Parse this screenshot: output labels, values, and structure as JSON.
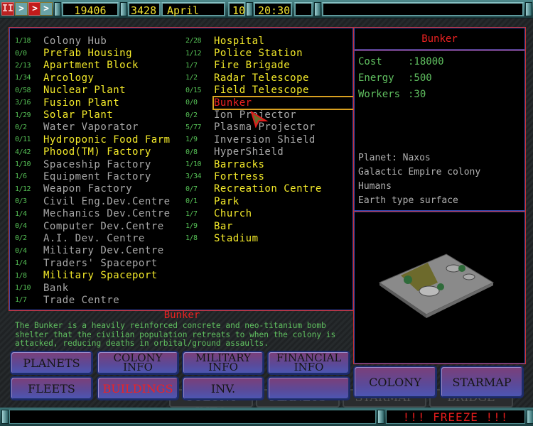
{
  "topbar": {
    "controls": [
      {
        "icon": "pause-icon",
        "glyph": "II"
      },
      {
        "icon": "play-icon",
        "glyph": ">"
      },
      {
        "icon": "fast-forward-icon",
        "glyph": ">"
      },
      {
        "icon": "fastest-forward-icon",
        "glyph": ">"
      }
    ],
    "credits": "19406",
    "year": "3428",
    "month": "April",
    "day": "10",
    "time": "20:30",
    "message": ""
  },
  "buildings": {
    "left": [
      {
        "count": "1/18",
        "name": "Colony Hub",
        "state": "unavail"
      },
      {
        "count": "0/0",
        "name": "Prefab Housing",
        "state": "avail"
      },
      {
        "count": "2/13",
        "name": "Apartment Block",
        "state": "avail"
      },
      {
        "count": "1/34",
        "name": "Arcology",
        "state": "avail"
      },
      {
        "count": "0/58",
        "name": "Nuclear Plant",
        "state": "avail"
      },
      {
        "count": "3/16",
        "name": "Fusion Plant",
        "state": "avail"
      },
      {
        "count": "1/29",
        "name": "Solar Plant",
        "state": "avail"
      },
      {
        "count": "0/2",
        "name": "Water Vaporator",
        "state": "unavail"
      },
      {
        "count": "0/11",
        "name": "Hydroponic Food Farm",
        "state": "avail"
      },
      {
        "count": "4/42",
        "name": "Phood(TM) Factory",
        "state": "avail"
      },
      {
        "count": "1/10",
        "name": "Spaceship Factory",
        "state": "unavail"
      },
      {
        "count": "1/6",
        "name": "Equipment Factory",
        "state": "unavail"
      },
      {
        "count": "1/12",
        "name": "Weapon Factory",
        "state": "unavail"
      },
      {
        "count": "0/3",
        "name": "Civil Eng.Dev.Centre",
        "state": "unavail"
      },
      {
        "count": "1/4",
        "name": "Mechanics Dev.Centre",
        "state": "unavail"
      },
      {
        "count": "0/4",
        "name": "Computer Dev.Centre",
        "state": "unavail"
      },
      {
        "count": "0/2",
        "name": "A.I. Dev. Centre",
        "state": "unavail"
      },
      {
        "count": "0/4",
        "name": "Military Dev.Centre",
        "state": "unavail"
      },
      {
        "count": "1/4",
        "name": "Traders' Spaceport",
        "state": "unavail"
      },
      {
        "count": "1/8",
        "name": "Military Spaceport",
        "state": "avail"
      },
      {
        "count": "1/10",
        "name": "Bank",
        "state": "unavail"
      },
      {
        "count": "1/7",
        "name": "Trade Centre",
        "state": "unavail"
      }
    ],
    "right": [
      {
        "count": "2/28",
        "name": "Hospital",
        "state": "avail"
      },
      {
        "count": "1/12",
        "name": "Police Station",
        "state": "avail"
      },
      {
        "count": "1/7",
        "name": "Fire Brigade",
        "state": "avail"
      },
      {
        "count": "1/2",
        "name": "Radar Telescope",
        "state": "avail"
      },
      {
        "count": "0/15",
        "name": "Field Telescope",
        "state": "avail"
      },
      {
        "count": "0/0",
        "name": "Bunker",
        "state": "selected"
      },
      {
        "count": "0/2",
        "name": "Ion Projector",
        "state": "unavail"
      },
      {
        "count": "5/77",
        "name": "Plasma Projector",
        "state": "unavail"
      },
      {
        "count": "1/9",
        "name": "Inversion Shield",
        "state": "unavail"
      },
      {
        "count": "0/8",
        "name": "HyperShield",
        "state": "unavail"
      },
      {
        "count": "1/10",
        "name": "Barracks",
        "state": "avail"
      },
      {
        "count": "3/34",
        "name": "Fortress",
        "state": "avail"
      },
      {
        "count": "0/7",
        "name": "Recreation Centre",
        "state": "avail"
      },
      {
        "count": "0/1",
        "name": "Park",
        "state": "avail"
      },
      {
        "count": "1/7",
        "name": "Church",
        "state": "avail"
      },
      {
        "count": "1/9",
        "name": "Bar",
        "state": "avail"
      },
      {
        "count": "1/8",
        "name": "Stadium",
        "state": "avail"
      }
    ]
  },
  "description": {
    "title": "Bunker",
    "text": "The Bunker is a heavily reinforced concrete and neo-titanium bomb shelter that the civilian population retreats to when the colony is attacked, reducing deaths in orbital/ground assaults."
  },
  "info": {
    "title": "Bunker",
    "stats": [
      {
        "label": "Cost",
        "value": ":18000"
      },
      {
        "label": "Energy",
        "value": ":500"
      },
      {
        "label": "Workers",
        "value": ":30"
      }
    ],
    "planet": [
      "Planet: Naxos",
      "Galactic Empire colony",
      "Humans",
      "Earth type surface"
    ]
  },
  "nav_buttons": {
    "planets": "PLANETS",
    "colony_info": [
      "COLONY",
      "INFO"
    ],
    "military_info": [
      "MILITARY",
      "INFO"
    ],
    "financial_info": [
      "FINANCIAL",
      "INFO"
    ],
    "fleets": "FLEETS",
    "buildings": "BUILDINGS",
    "inv": "INV.",
    "empty": "",
    "colony": "COLONY",
    "starmap": "STARMAP"
  },
  "background_tabs": [
    "COLONY INFO",
    "PLANETS",
    "STARMAP",
    "BRIDGE"
  ],
  "status": {
    "message": "!!! FREEZE !!!"
  },
  "colors": {
    "available": "#f4ea2a",
    "unavailable": "#a8a8a8",
    "selected": "#ee2222",
    "count": "#55c055",
    "lcd_text": "#f0e030"
  }
}
